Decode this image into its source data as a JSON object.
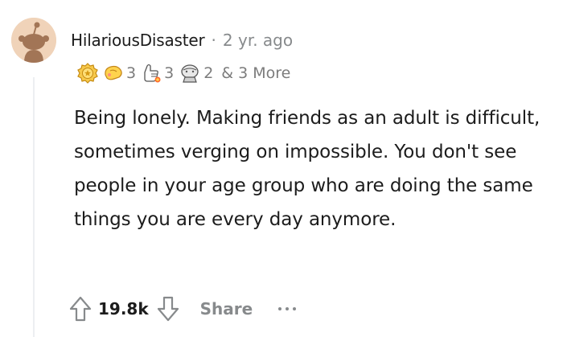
{
  "comment": {
    "username": "HilariousDisaster",
    "separator": "·",
    "timestamp": "2 yr. ago",
    "awards": [
      {
        "icon": "gold-award-icon",
        "count": ""
      },
      {
        "icon": "helpful-award-icon",
        "count": "3"
      },
      {
        "icon": "wholesome-award-icon",
        "count": "3"
      },
      {
        "icon": "hugz-award-icon",
        "count": "2"
      }
    ],
    "more_awards": "& 3 More",
    "body": "Being lonely. Making friends as an adult is difficult, sometimes verging on impossible. You don't see people in your age group who are doing the same things you are every day anymore.",
    "score": "19.8k",
    "share_label": "Share",
    "colors": {
      "text": "#1c1c1c",
      "meta": "#878a8c",
      "thread_line": "#edeff1",
      "avatar_bg": "#f0d3b9"
    }
  }
}
